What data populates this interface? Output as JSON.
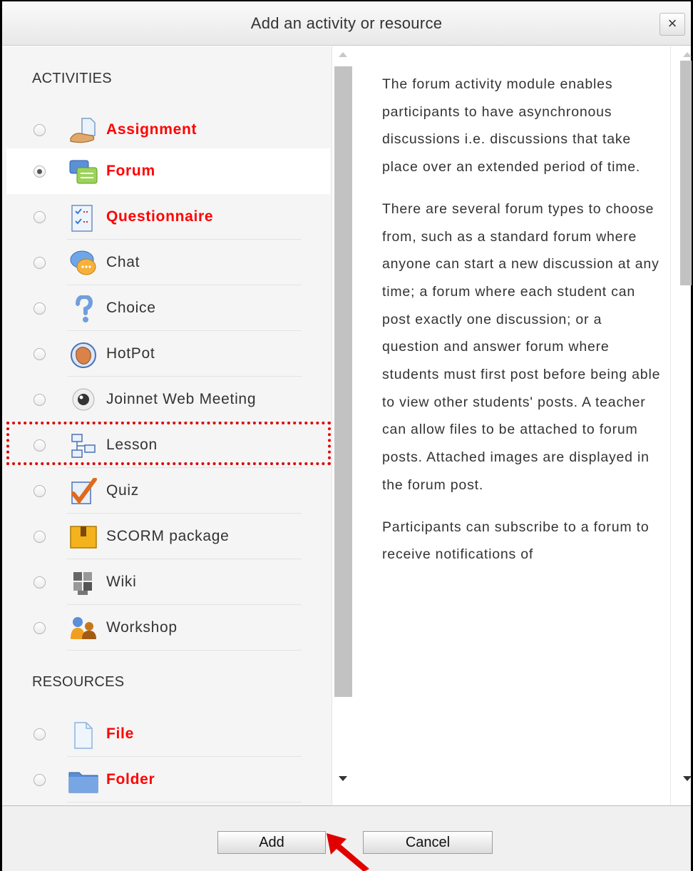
{
  "dialog": {
    "title": "Add an activity or resource",
    "close_label": "×"
  },
  "activities": {
    "heading": "ACTIVITIES",
    "items": [
      {
        "label": "Assignment",
        "icon": "assignment-icon",
        "highlight": true,
        "selected": false
      },
      {
        "label": "Forum",
        "icon": "forum-icon",
        "highlight": true,
        "selected": true
      },
      {
        "label": "Questionnaire",
        "icon": "questionnaire-icon",
        "highlight": true,
        "selected": false
      },
      {
        "label": "Chat",
        "icon": "chat-icon",
        "highlight": false,
        "selected": false
      },
      {
        "label": "Choice",
        "icon": "choice-icon",
        "highlight": false,
        "selected": false
      },
      {
        "label": "HotPot",
        "icon": "hotpot-icon",
        "highlight": false,
        "selected": false
      },
      {
        "label": "Joinnet Web Meeting",
        "icon": "webcam-icon",
        "highlight": false,
        "selected": false
      },
      {
        "label": "Lesson",
        "icon": "lesson-icon",
        "highlight": false,
        "selected": false
      },
      {
        "label": "Quiz",
        "icon": "quiz-icon",
        "highlight": false,
        "selected": false
      },
      {
        "label": "SCORM package",
        "icon": "scorm-icon",
        "highlight": false,
        "selected": false
      },
      {
        "label": "Wiki",
        "icon": "wiki-icon",
        "highlight": false,
        "selected": false
      },
      {
        "label": "Workshop",
        "icon": "workshop-icon",
        "highlight": false,
        "selected": false
      }
    ]
  },
  "resources": {
    "heading": "RESOURCES",
    "items": [
      {
        "label": "File",
        "icon": "file-icon",
        "highlight": true,
        "selected": false
      },
      {
        "label": "Folder",
        "icon": "folder-icon",
        "highlight": true,
        "selected": false
      }
    ]
  },
  "help": {
    "paragraphs": [
      "The forum activity module enables participants to have asynchronous discussions i.e. discussions that take place over an extended period of time.",
      "There are several forum types to choose from, such as a standard forum where anyone can start a new discussion at any time; a forum where each student can post exactly one discussion; or a question and answer forum where students must first post before being able to view other students' posts. A teacher can allow files to be attached to forum posts. Attached images are displayed in the forum post.",
      "Participants can subscribe to a forum to receive notifications of"
    ]
  },
  "footer": {
    "add_label": "Add",
    "cancel_label": "Cancel"
  },
  "colors": {
    "highlight_text": "#ff0000",
    "annotation": "#e00000"
  }
}
